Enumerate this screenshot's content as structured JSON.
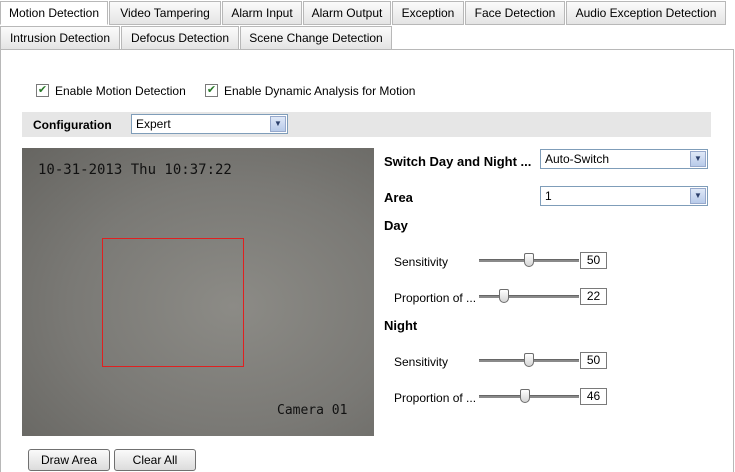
{
  "tabs_row1": [
    {
      "label": "Motion Detection",
      "active": true
    },
    {
      "label": "Video Tampering"
    },
    {
      "label": "Alarm Input"
    },
    {
      "label": "Alarm Output"
    },
    {
      "label": "Exception"
    },
    {
      "label": "Face Detection"
    },
    {
      "label": "Audio Exception Detection"
    }
  ],
  "tabs_row2": [
    {
      "label": "Intrusion Detection"
    },
    {
      "label": "Defocus Detection"
    },
    {
      "label": "Scene Change Detection"
    }
  ],
  "options": {
    "enable_motion_label": "Enable Motion Detection",
    "enable_motion_checked": true,
    "enable_dynamic_label": "Enable Dynamic Analysis for Motion",
    "enable_dynamic_checked": true
  },
  "configuration": {
    "label": "Configuration",
    "value": "Expert"
  },
  "video": {
    "osd_timestamp": "10-31-2013 Thu 10:37:22",
    "osd_camera": "Camera 01",
    "area_box_color": "#e02020"
  },
  "settings": {
    "switch_label": "Switch Day and Night ...",
    "switch_value": "Auto-Switch",
    "area_label": "Area",
    "area_value": "1",
    "day_label": "Day",
    "day_sensitivity_label": "Sensitivity",
    "day_sensitivity_value": "50",
    "day_proportion_label": "Proportion of ...",
    "day_proportion_value": "22",
    "night_label": "Night",
    "night_sensitivity_label": "Sensitivity",
    "night_sensitivity_value": "50",
    "night_proportion_label": "Proportion of ...",
    "night_proportion_value": "46"
  },
  "buttons": {
    "draw_area": "Draw Area",
    "clear_all": "Clear All"
  },
  "icons": {
    "checkbox": "checkmark-icon",
    "dropdown": "chevron-down-icon"
  }
}
